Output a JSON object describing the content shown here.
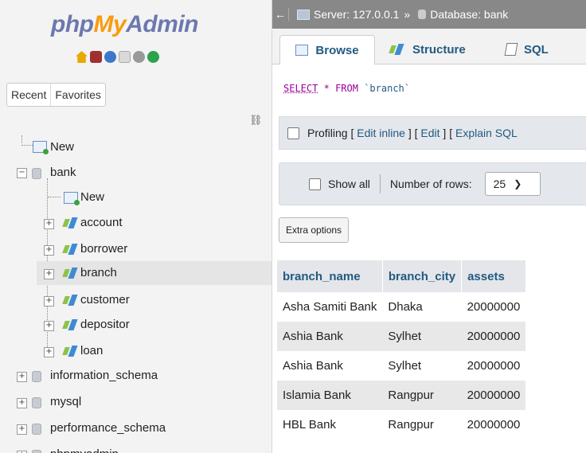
{
  "sidebar": {
    "logo": {
      "part1": "php",
      "part2": "My",
      "part3": "Admin"
    },
    "quick_icons": [
      "home-icon",
      "logout-icon",
      "help-icon",
      "docs-icon",
      "settings-icon",
      "reload-icon"
    ],
    "recent_label": "Recent",
    "favorites_label": "Favorites",
    "link_icon": "link-icon",
    "tree": {
      "new_top": "New",
      "bank": "bank",
      "bank_new": "New",
      "tables": [
        "account",
        "borrower",
        "branch",
        "customer",
        "depositor",
        "loan"
      ],
      "selected_table": "branch",
      "databases": [
        "information_schema",
        "mysql",
        "performance_schema",
        "phpmyadmin"
      ]
    }
  },
  "breadcrumb": {
    "server_label": "Server: 127.0.0.1",
    "separator": "»",
    "database_label": "Database: bank"
  },
  "tabs": {
    "browse": "Browse",
    "structure": "Structure",
    "sql": "SQL"
  },
  "query": {
    "select": "SELECT",
    "star": "*",
    "from": "FROM",
    "table": "`branch`"
  },
  "profiling": {
    "label": "Profiling",
    "edit_inline": "Edit inline",
    "edit": "Edit",
    "explain": "Explain SQL"
  },
  "navigation": {
    "show_all": "Show all",
    "rows_label": "Number of rows:",
    "rows_value": "25"
  },
  "extra_options": "Extra options",
  "results": {
    "columns": [
      "branch_name",
      "branch_city",
      "assets"
    ],
    "rows": [
      [
        "Asha Samiti Bank",
        "Dhaka",
        "20000000"
      ],
      [
        "Ashia Bank",
        "Sylhet",
        "20000000"
      ],
      [
        "Ashia Bank",
        "Sylhet",
        "20000000"
      ],
      [
        "Islamia Bank",
        "Rangpur",
        "20000000"
      ],
      [
        "HBL Bank",
        "Rangpur",
        "20000000"
      ]
    ]
  }
}
